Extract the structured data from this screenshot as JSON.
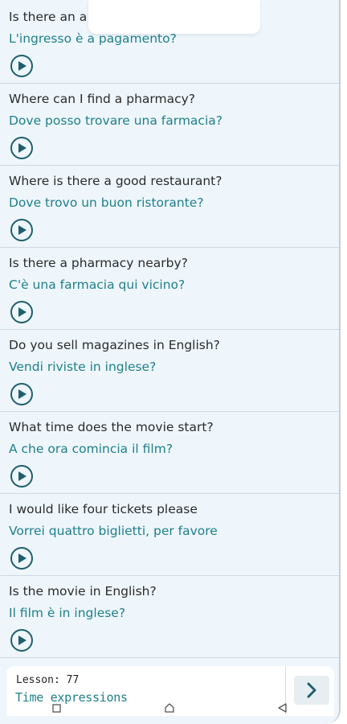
{
  "phrases": [
    {
      "english": "Is there an a",
      "italian": "L'ingresso è a pagamento?"
    },
    {
      "english": "Where can I find a pharmacy?",
      "italian": "Dove posso trovare una farmacia?"
    },
    {
      "english": "Where is there a good restaurant?",
      "italian": "Dove trovo un buon ristorante?"
    },
    {
      "english": "Is there a pharmacy nearby?",
      "italian": "C'è una farmacia qui vicino?"
    },
    {
      "english": "Do you sell magazines in English?",
      "italian": "Vendi riviste in inglese?"
    },
    {
      "english": "What time does the movie start?",
      "italian": "A che ora comincia il film?"
    },
    {
      "english": "I would like four tickets please",
      "italian": "Vorrei quattro biglietti, per favore"
    },
    {
      "english": "Is the movie in English?",
      "italian": "Il film è in inglese?"
    }
  ],
  "icons": {
    "play": "play-circle-icon",
    "next": "chevron-right-icon",
    "nav_recents": "square-icon",
    "nav_home": "home-icon",
    "nav_back": "back-triangle-icon"
  },
  "footer": {
    "lesson_label": "Lesson: 77",
    "lesson_title": "Time expressions"
  },
  "colors": {
    "background": "#eef6fc",
    "english_text": "#2b2b2b",
    "italian_text": "#1f7f8a",
    "play_icon": "#1f5f6c"
  }
}
